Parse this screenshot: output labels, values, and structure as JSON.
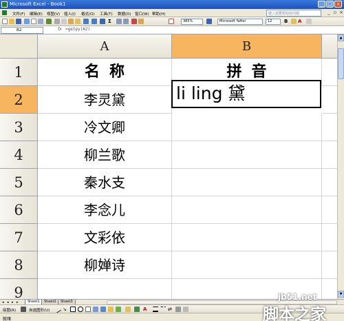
{
  "window": {
    "title": "Microsoft Excel - Book1"
  },
  "menu": {
    "items": [
      "文件(F)",
      "编辑(E)",
      "视图(V)",
      "插入(I)",
      "格式(O)",
      "工具(T)",
      "数据(D)",
      "窗口(W)",
      "帮助(H)"
    ],
    "help_placeholder": "键入需要帮助的问题"
  },
  "toolbar": {
    "zoom": "385%",
    "font": "Microsoft YaHei",
    "size": "12"
  },
  "formula_bar": {
    "name_box": "B2",
    "fx": "fx",
    "formula": "=getpy(A2)"
  },
  "columns": [
    "A",
    "B"
  ],
  "rows": [
    "1",
    "2",
    "3",
    "4",
    "5",
    "6",
    "7",
    "8",
    "9"
  ],
  "cells": {
    "A": [
      "名称",
      "李灵黛",
      "冷文卿",
      "柳兰歌",
      "秦水支",
      "李念儿",
      "文彩依",
      "柳婵诗",
      ""
    ],
    "B": [
      "拼音",
      "li ling 黛",
      "",
      "",
      "",
      "",
      "",
      "",
      ""
    ]
  },
  "sheets": [
    "Sheet1",
    "Sheet2",
    "Sheet3"
  ],
  "draw_bar": {
    "draw": "绘图(R)",
    "autoshapes": "自选图形(U)"
  },
  "status": {
    "text": "就绪"
  },
  "watermark": {
    "url": "jb51.net",
    "name": "脚本之家"
  }
}
